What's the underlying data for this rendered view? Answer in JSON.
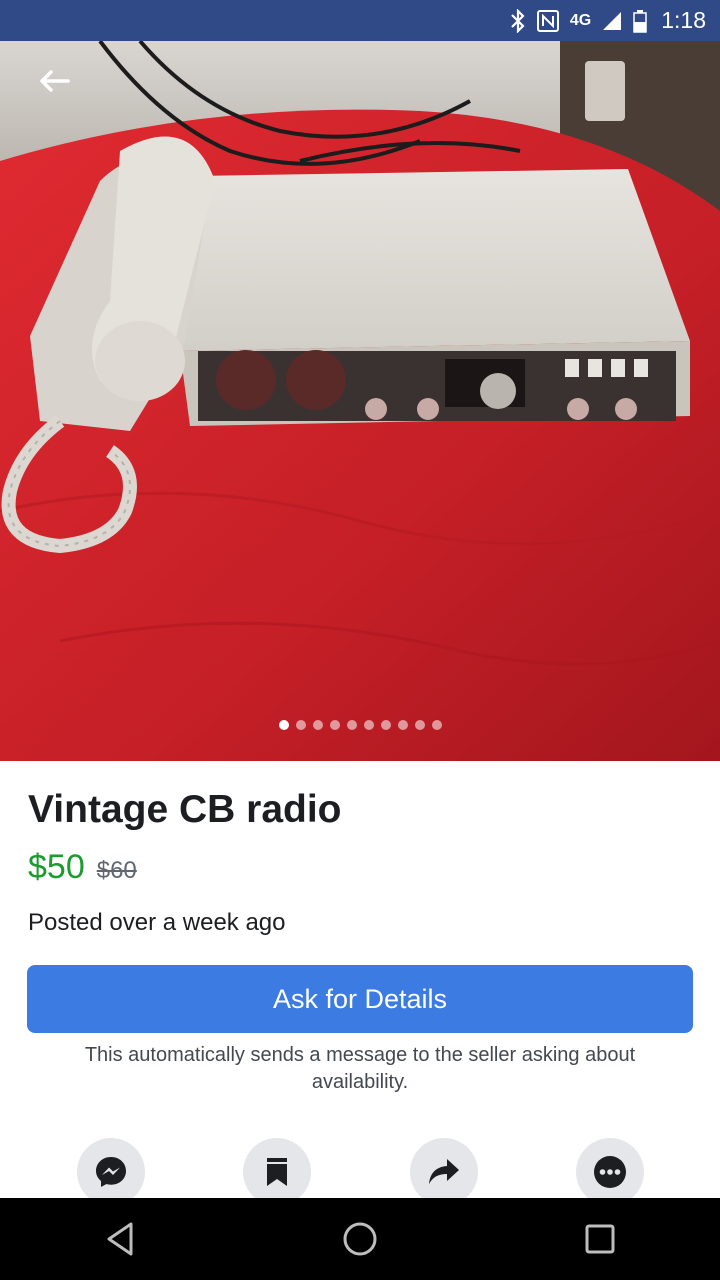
{
  "status_bar": {
    "time": "1:18",
    "network": "4G",
    "icons": [
      "bluetooth-icon",
      "nfc-icon",
      "lte-icon",
      "signal-icon",
      "battery-icon"
    ]
  },
  "listing": {
    "title": "Vintage CB radio",
    "price": "$50",
    "original_price": "$60",
    "posted": "Posted over a week ago",
    "photo_count": 10,
    "current_photo": 1
  },
  "cta": {
    "label": "Ask for Details",
    "note": "This automatically sends a message to the seller asking about availability."
  },
  "actions": [
    {
      "name": "messenger-button",
      "icon": "messenger-icon"
    },
    {
      "name": "save-button",
      "icon": "bookmark-icon"
    },
    {
      "name": "share-button",
      "icon": "share-icon"
    },
    {
      "name": "more-button",
      "icon": "more-icon"
    }
  ],
  "colors": {
    "status_bar": "#2f4a86",
    "price_green": "#1a9c2e",
    "button_blue": "#3b7be2",
    "table_red": "#c8222a"
  }
}
